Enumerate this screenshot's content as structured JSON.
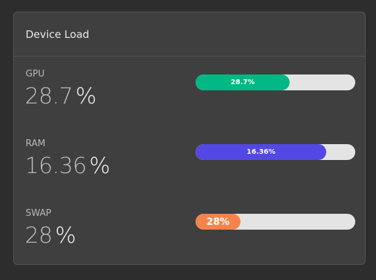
{
  "card": {
    "title": "Device Load"
  },
  "metrics": [
    {
      "label": "GPU",
      "value": "28.7",
      "unit": "%",
      "bar_text": "28.7%",
      "fill_fraction": 0.59,
      "color": "#00b884"
    },
    {
      "label": "RAM",
      "value": "16.36",
      "unit": "%",
      "bar_text": "16.36%",
      "fill_fraction": 0.82,
      "color": "#5348e3"
    },
    {
      "label": "SWAP",
      "value": "28",
      "unit": "%",
      "bar_text": "28%",
      "fill_fraction": 0.28,
      "color": "#f7834c"
    }
  ]
}
